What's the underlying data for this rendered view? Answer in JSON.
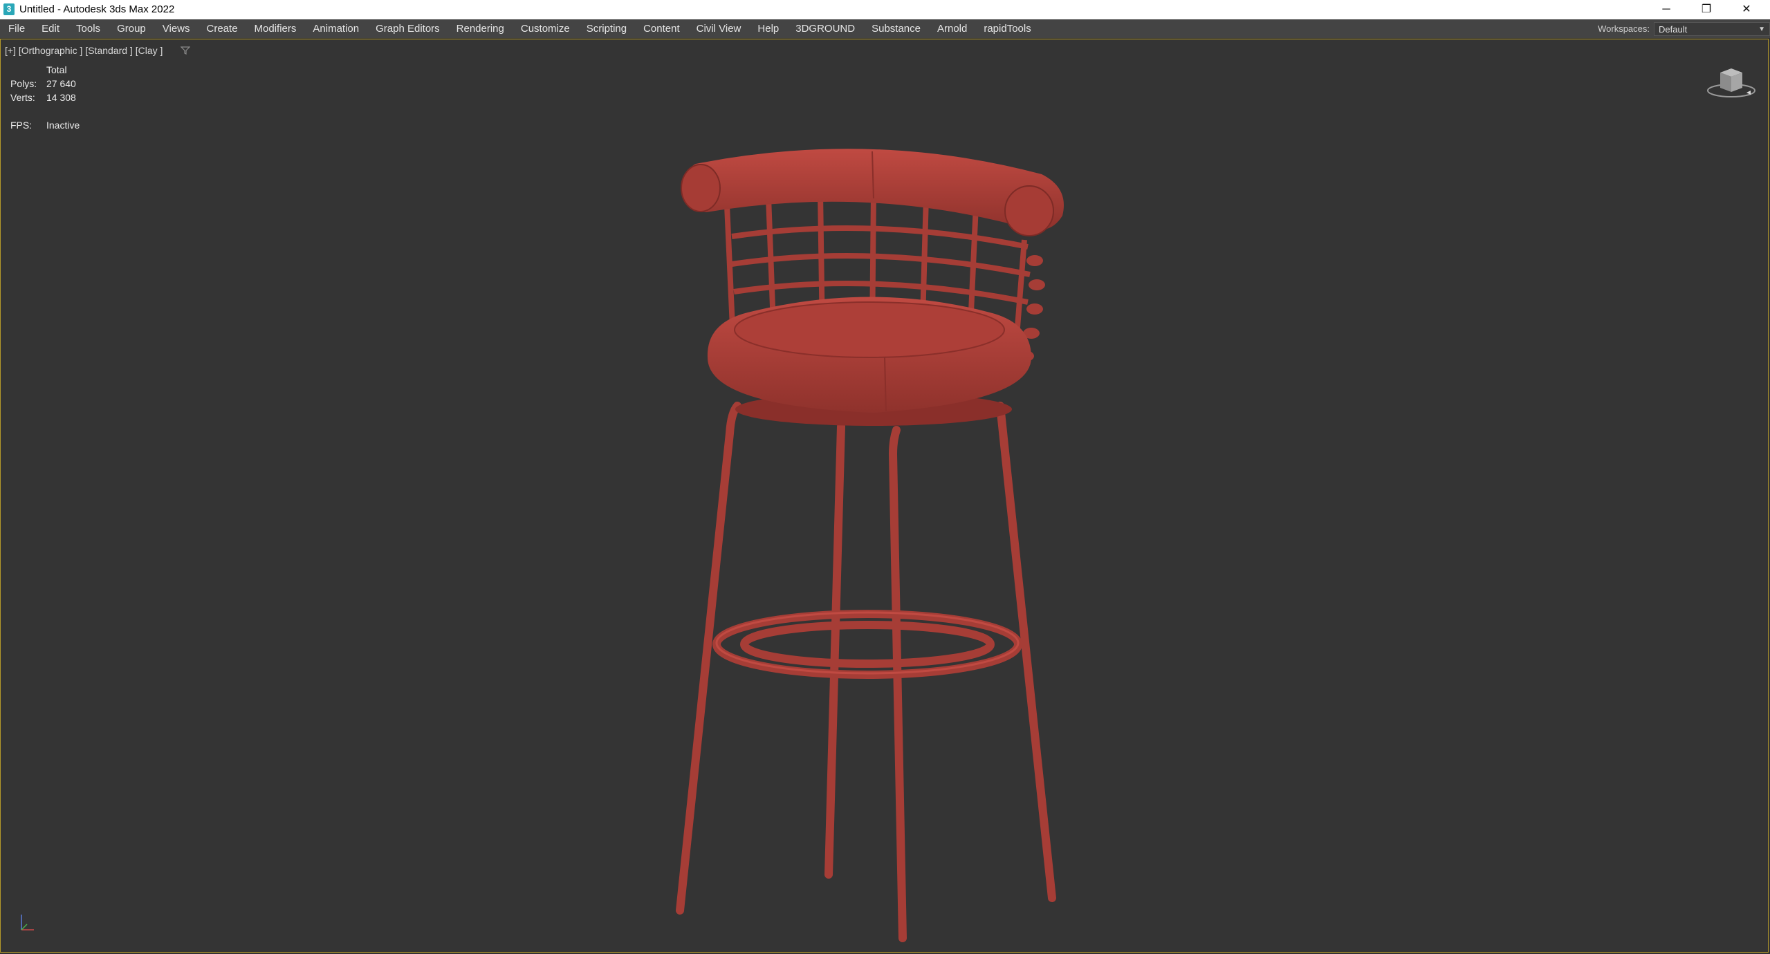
{
  "window": {
    "title": "Untitled - Autodesk 3ds Max 2022",
    "app_icon": "3",
    "controls": {
      "minimize": "─",
      "restore": "❐",
      "close": "✕"
    }
  },
  "menu": {
    "items": [
      "File",
      "Edit",
      "Tools",
      "Group",
      "Views",
      "Create",
      "Modifiers",
      "Animation",
      "Graph Editors",
      "Rendering",
      "Customize",
      "Scripting",
      "Content",
      "Civil View",
      "Help",
      "3DGROUND",
      "Substance",
      "Arnold",
      "rapidTools"
    ],
    "workspaces_label": "Workspaces:",
    "workspace_value": "Default"
  },
  "viewport": {
    "label": "[+] [Orthographic ] [Standard ] [Clay ]",
    "stats": {
      "header": "Total",
      "polys_label": "Polys:",
      "polys_value": "27 640",
      "verts_label": "Verts:",
      "verts_value": "14 308",
      "fps_label": "FPS:",
      "fps_value": "Inactive"
    }
  },
  "colors": {
    "clay": "#b0413a",
    "clay_dark": "#8a2f2a",
    "background": "#343434",
    "menubar": "#444444",
    "active_border": "#b59a2a"
  },
  "icons": [
    "filter-icon",
    "viewcube-icon",
    "axis-tripod-icon"
  ]
}
